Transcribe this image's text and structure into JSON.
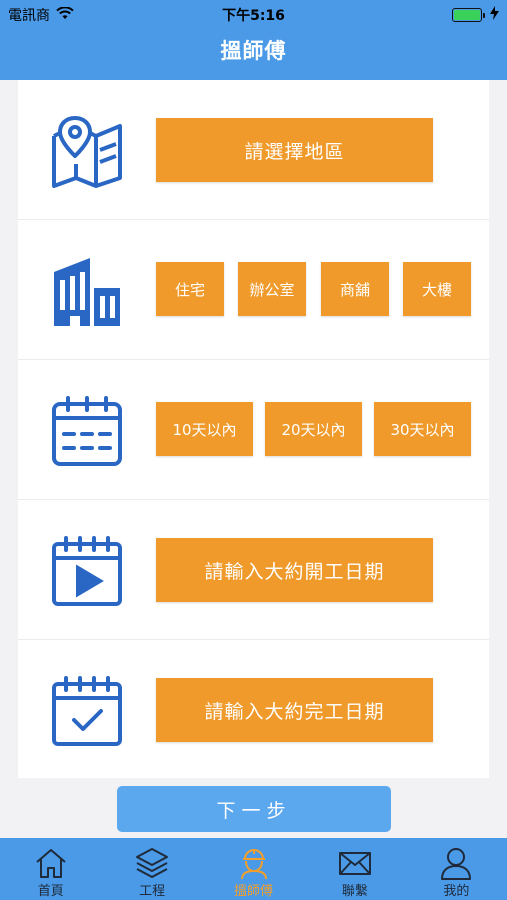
{
  "status": {
    "carrier": "電訊商",
    "time": "下午5:16"
  },
  "header": {
    "title": "搵師傅"
  },
  "rows": {
    "region": {
      "button": "請選擇地區",
      "icon": "map-pin-icon"
    },
    "property": {
      "options": [
        "住宅",
        "辦公室",
        "商舖",
        "大樓"
      ],
      "icon": "building-icon"
    },
    "timeframe": {
      "options": [
        "10天以內",
        "20天以內",
        "30天以內"
      ],
      "icon": "calendar-icon"
    },
    "start": {
      "button": "請輸入大約開工日期",
      "icon": "calendar-play-icon"
    },
    "end": {
      "button": "請輸入大約完工日期",
      "icon": "calendar-check-icon"
    }
  },
  "next_button": "下一步",
  "tabs": [
    {
      "label": "首頁",
      "icon": "home-icon",
      "active": false
    },
    {
      "label": "工程",
      "icon": "layers-icon",
      "active": false
    },
    {
      "label": "搵師傅",
      "icon": "worker-icon",
      "active": true
    },
    {
      "label": "聯繫",
      "icon": "mail-icon",
      "active": false
    },
    {
      "label": "我的",
      "icon": "user-icon",
      "active": false
    }
  ],
  "colors": {
    "primary": "#4a9ae8",
    "accent": "#ef9a2a",
    "icon": "#2a66c4"
  }
}
